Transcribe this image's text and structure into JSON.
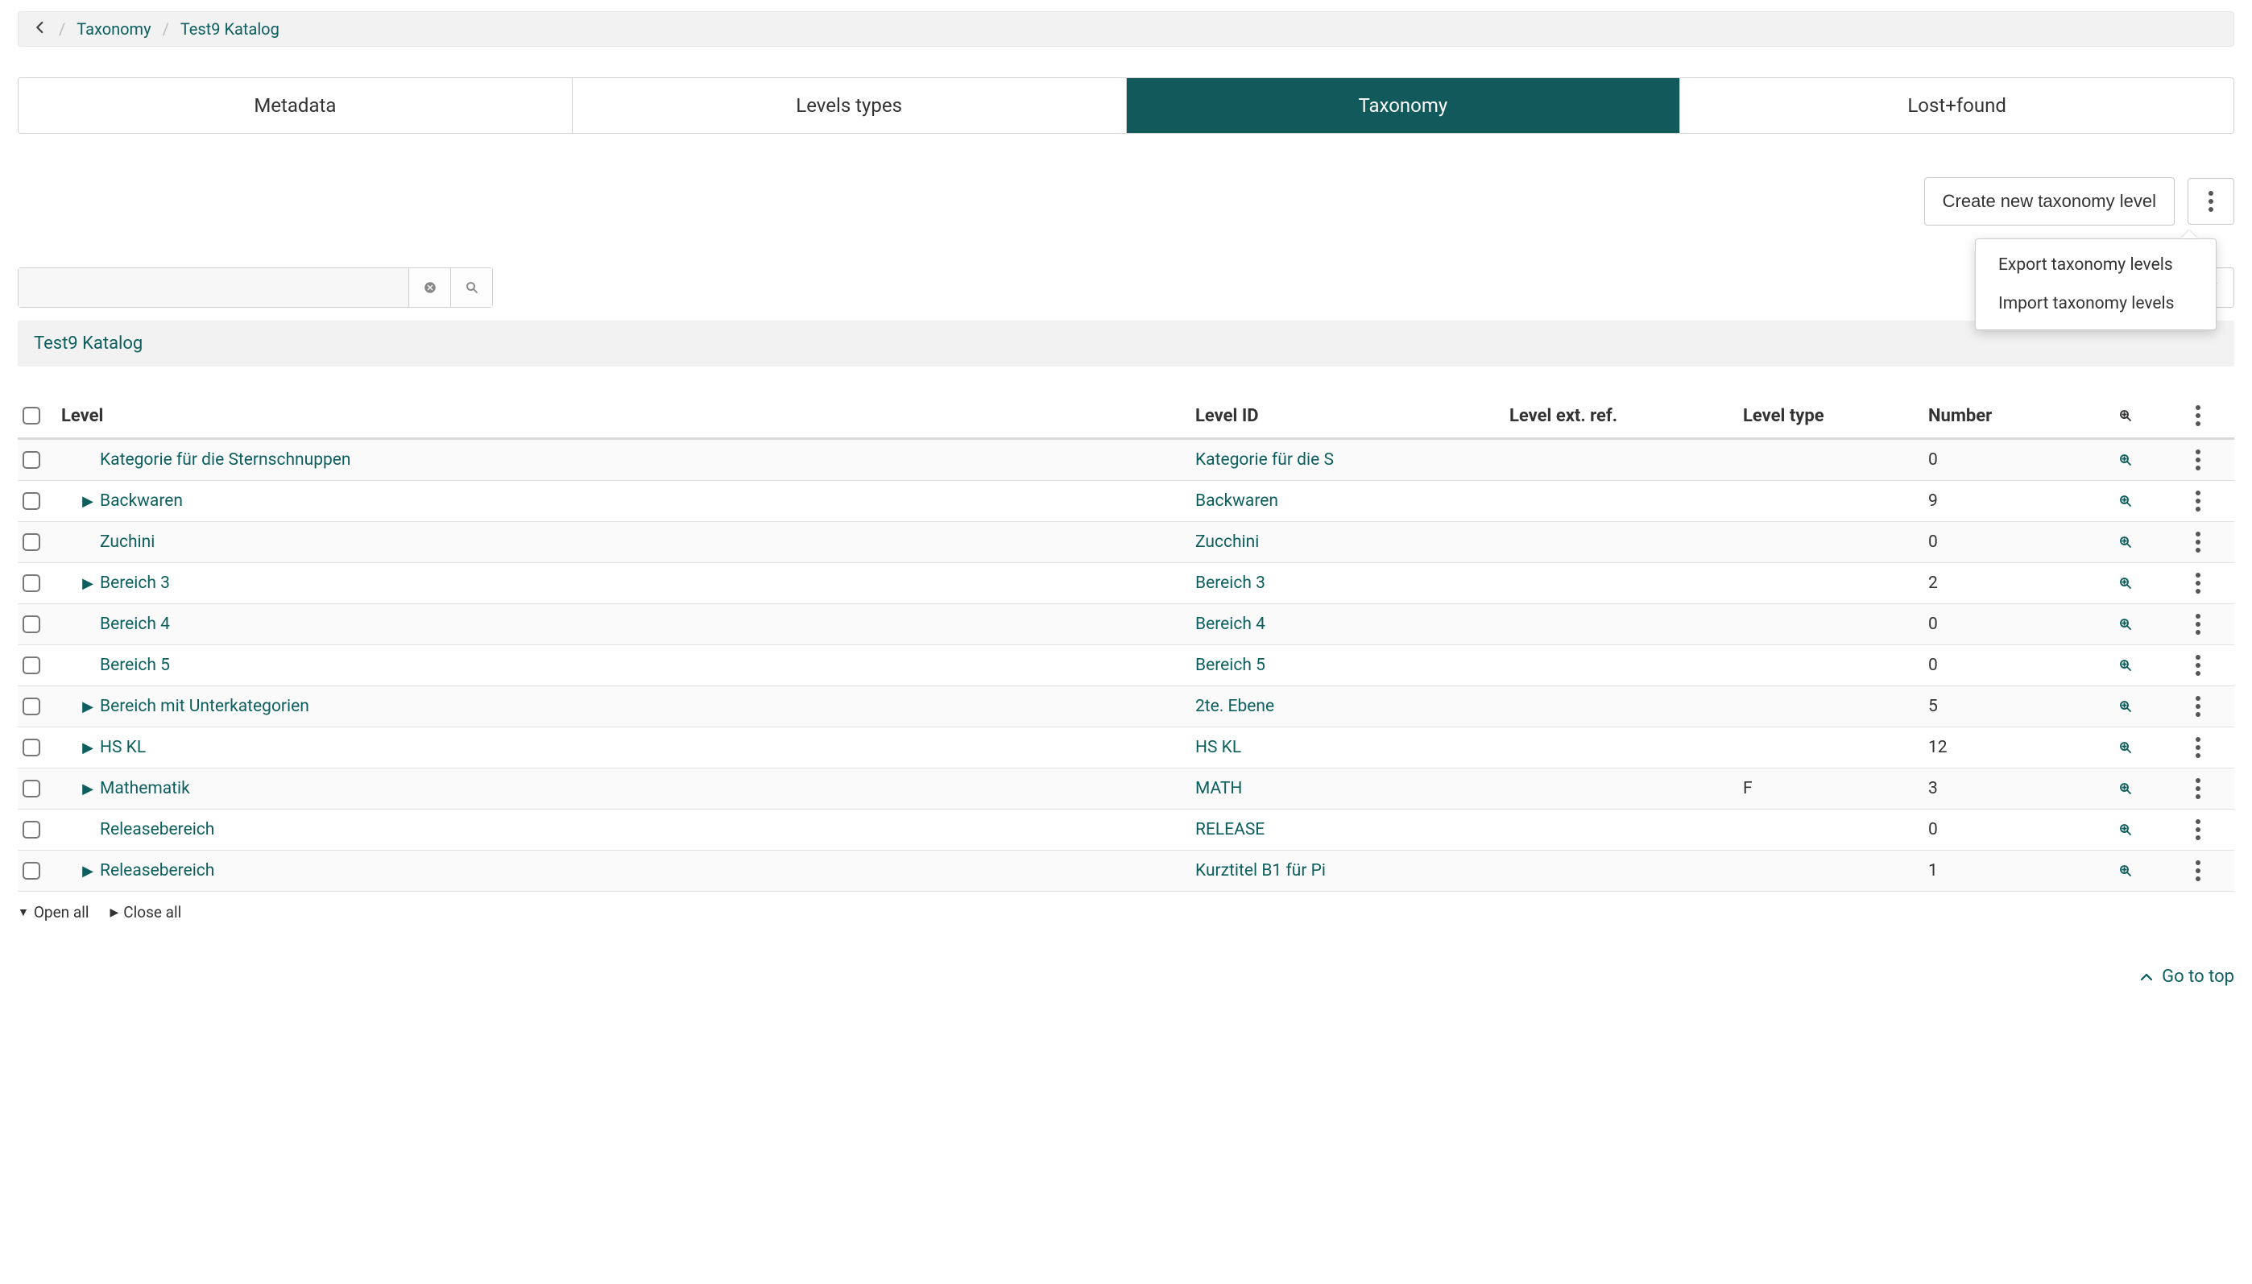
{
  "breadcrumb": {
    "back_icon_name": "chevron-left-icon",
    "items": [
      {
        "label": "Taxonomy"
      },
      {
        "label": "Test9 Katalog"
      }
    ]
  },
  "tabs": [
    {
      "label": "Metadata",
      "active": false
    },
    {
      "label": "Levels types",
      "active": false
    },
    {
      "label": "Taxonomy",
      "active": true
    },
    {
      "label": "Lost+found",
      "active": false
    }
  ],
  "actions": {
    "create_label": "Create new taxonomy level",
    "menu": [
      {
        "label": "Export taxonomy levels"
      },
      {
        "label": "Import taxonomy levels"
      }
    ]
  },
  "search": {
    "value": "",
    "placeholder": ""
  },
  "catalog_title": "Test9 Katalog",
  "columns": {
    "level": "Level",
    "level_id": "Level ID",
    "level_ext_ref": "Level ext. ref.",
    "level_type": "Level type",
    "number": "Number"
  },
  "rows": [
    {
      "has_children": false,
      "level": "Kategorie für die Sternschnuppen",
      "level_id": "Kategorie für die S",
      "ext_ref": "",
      "type": "",
      "number": "0"
    },
    {
      "has_children": true,
      "level": "Backwaren",
      "level_id": "Backwaren",
      "ext_ref": "",
      "type": "",
      "number": "9"
    },
    {
      "has_children": false,
      "level": "Zuchini",
      "level_id": "Zucchini",
      "ext_ref": "",
      "type": "",
      "number": "0"
    },
    {
      "has_children": true,
      "level": "Bereich 3",
      "level_id": "Bereich 3",
      "ext_ref": "",
      "type": "",
      "number": "2"
    },
    {
      "has_children": false,
      "level": "Bereich 4",
      "level_id": "Bereich 4",
      "ext_ref": "",
      "type": "",
      "number": "0"
    },
    {
      "has_children": false,
      "level": "Bereich 5",
      "level_id": "Bereich 5",
      "ext_ref": "",
      "type": "",
      "number": "0"
    },
    {
      "has_children": true,
      "level": "Bereich mit Unterkategorien",
      "level_id": "2te. Ebene",
      "ext_ref": "",
      "type": "",
      "number": "5"
    },
    {
      "has_children": true,
      "level": "HS KL",
      "level_id": "HS KL",
      "ext_ref": "",
      "type": "",
      "number": "12"
    },
    {
      "has_children": true,
      "level": "Mathematik",
      "level_id": "MATH",
      "ext_ref": "",
      "type": "F",
      "number": "3"
    },
    {
      "has_children": false,
      "level": "Releasebereich",
      "level_id": "RELEASE",
      "ext_ref": "",
      "type": "",
      "number": "0"
    },
    {
      "has_children": true,
      "level": "Releasebereich",
      "level_id": "Kurztitel B1 für Pi",
      "ext_ref": "",
      "type": "",
      "number": "1"
    }
  ],
  "tree_controls": {
    "open_all": "Open all",
    "close_all": "Close all"
  },
  "go_to_top": "Go to top"
}
